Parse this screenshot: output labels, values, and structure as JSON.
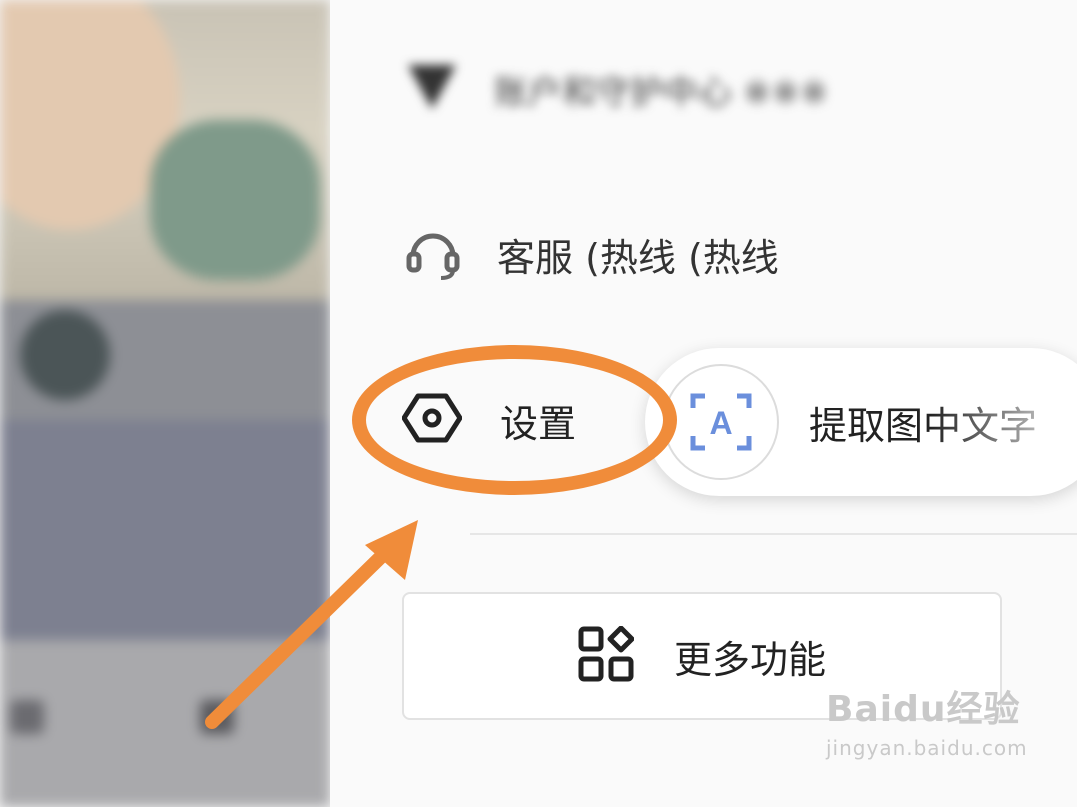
{
  "menu": {
    "network_item": "账户和守护中心 ※※※",
    "service_item": "客服 (热线 (热线",
    "settings_item": "设置",
    "more_button": "更多功能"
  },
  "ocr_popup": {
    "label": "提取图中文字",
    "icon_letter": "A"
  },
  "watermark": {
    "main": "Baidu经验",
    "sub": "jingyan.baidu.com"
  },
  "colors": {
    "annotation": "#f08c3a",
    "ocr_accent": "#6b8fdc"
  }
}
